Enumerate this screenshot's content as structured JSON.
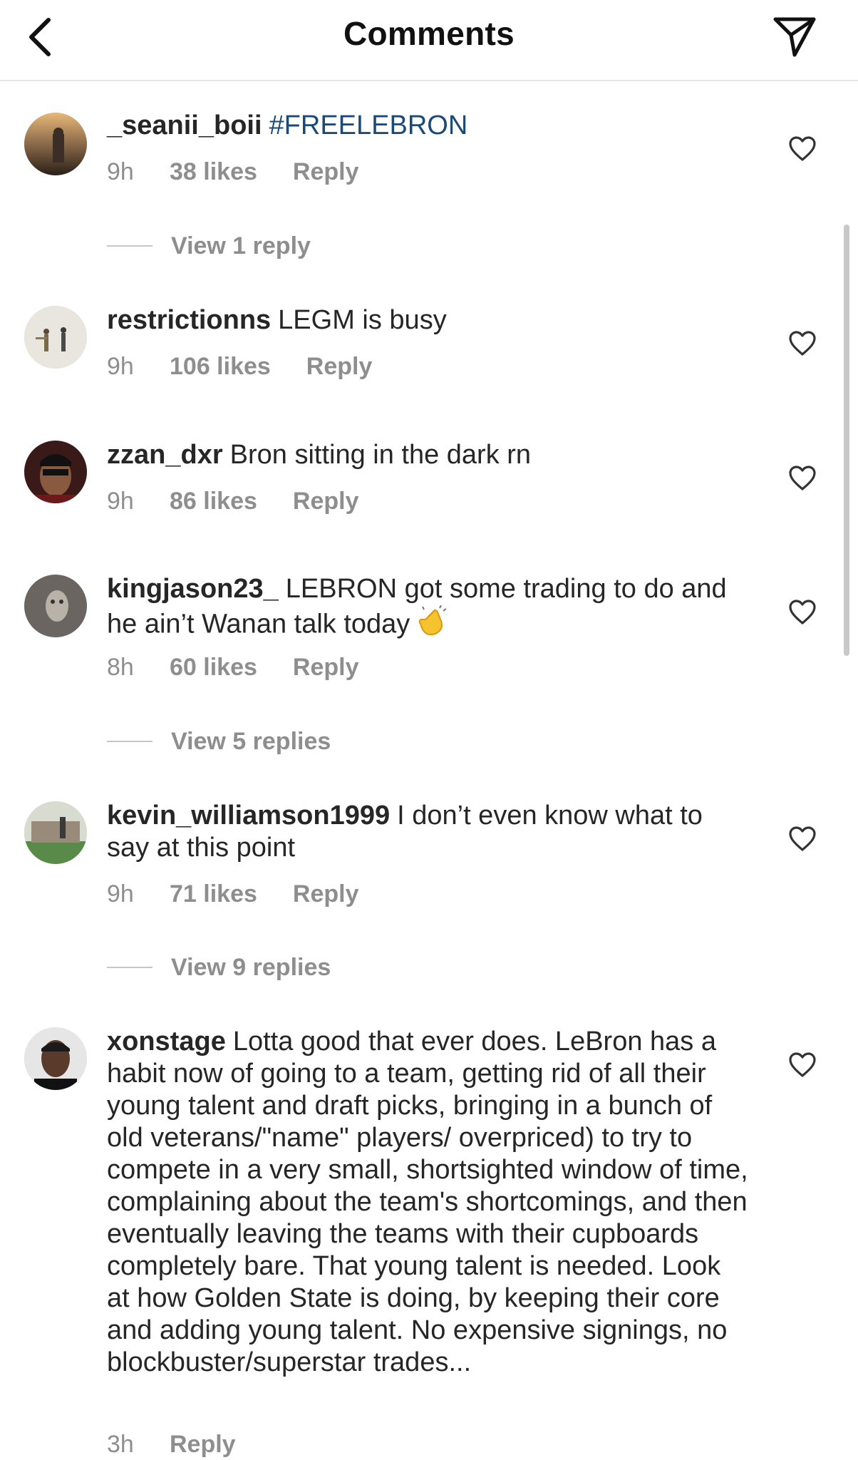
{
  "header": {
    "title": "Comments"
  },
  "comments": [
    {
      "username": "_seanii_boii",
      "text": "#FREELEBRON",
      "time": "9h",
      "likes": "38 likes",
      "reply": "Reply",
      "view_replies": "View 1 reply"
    },
    {
      "username": "restrictionns",
      "text": "LEGM is busy",
      "time": "9h",
      "likes": "106 likes",
      "reply": "Reply"
    },
    {
      "username": "zzan_dxr",
      "text": "Bron sitting in the dark rn",
      "time": "9h",
      "likes": "86 likes",
      "reply": "Reply"
    },
    {
      "username": "kingjason23_",
      "text": "LEBRON got some trading to do and he ain’t Wanan talk today",
      "time": "8h",
      "likes": "60 likes",
      "reply": "Reply",
      "view_replies": "View 5 replies"
    },
    {
      "username": "kevin_williamson1999",
      "text": "I don’t even know what to say at this point",
      "time": "9h",
      "likes": "71 likes",
      "reply": "Reply",
      "view_replies": "View 9 replies"
    },
    {
      "username": "xonstage",
      "text": "Lotta good that ever does. LeBron has a habit now of going to a team, getting rid of all their young talent and draft picks, bringing in a bunch of old veterans/\"name\" players/ overpriced) to try to compete in a very small, shortsighted window of time, complaining about the team's shortcomings, and then eventually leaving the teams with their cupboards completely bare. That young talent is needed. Look at how Golden State is doing, by keeping their core and adding young talent. No expensive signings, no blockbuster/superstar trades...",
      "time": "3h",
      "reply": "Reply"
    }
  ],
  "icons": {
    "back": "chevron-left-icon",
    "send": "paper-plane-icon",
    "like": "heart-outline-icon",
    "emoji": "clapping-hands-emoji"
  },
  "colors": {
    "hashtag": "#1c4a78",
    "secondary_text": "#8e8e8e",
    "primary_text": "#262626"
  }
}
